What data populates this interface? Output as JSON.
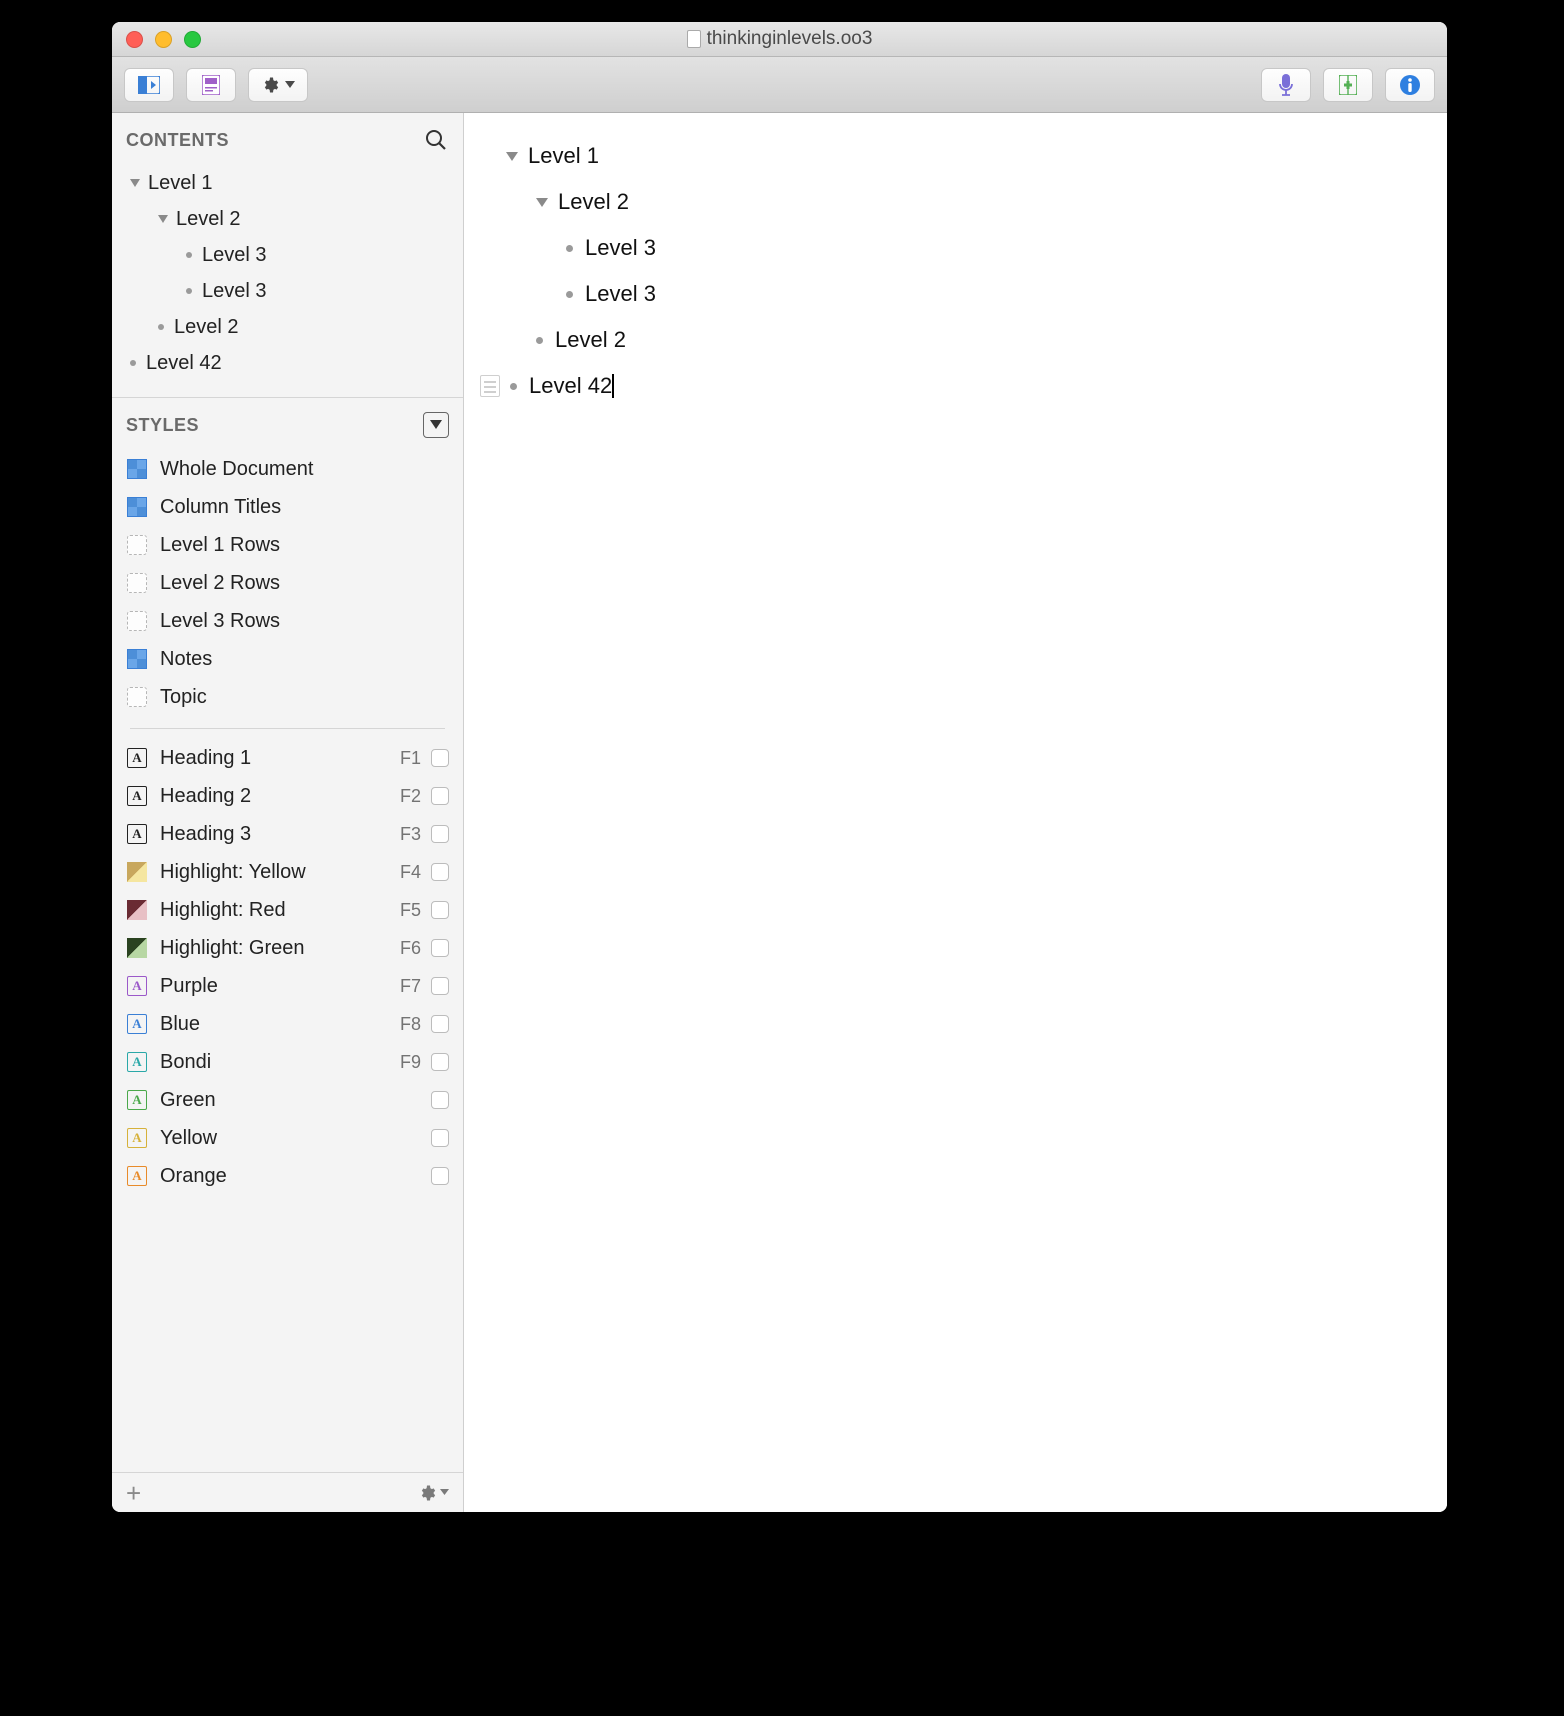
{
  "window": {
    "title": "thinkinginlevels.oo3"
  },
  "sidebar": {
    "contents_title": "CONTENTS",
    "styles_title": "STYLES",
    "tree": [
      {
        "label": "Level 1",
        "indent": 0,
        "marker": "tri"
      },
      {
        "label": "Level 2",
        "indent": 1,
        "marker": "tri"
      },
      {
        "label": "Level 3",
        "indent": 2,
        "marker": "bullet"
      },
      {
        "label": "Level 3",
        "indent": 2,
        "marker": "bullet"
      },
      {
        "label": "Level 2",
        "indent": 1,
        "marker": "bullet"
      },
      {
        "label": "Level 42",
        "indent": 0,
        "marker": "bullet"
      }
    ],
    "structural_styles": [
      {
        "label": "Whole Document",
        "icon": "blue"
      },
      {
        "label": "Column Titles",
        "icon": "blue"
      },
      {
        "label": "Level 1 Rows",
        "icon": "dashed"
      },
      {
        "label": "Level 2 Rows",
        "icon": "dashed"
      },
      {
        "label": "Level 3 Rows",
        "icon": "dashed"
      },
      {
        "label": "Notes",
        "icon": "blue"
      },
      {
        "label": "Topic",
        "icon": "dashed"
      }
    ],
    "named_styles": [
      {
        "label": "Heading 1",
        "shortcut": "F1",
        "icon": "A",
        "color": "#222"
      },
      {
        "label": "Heading 2",
        "shortcut": "F2",
        "icon": "A",
        "color": "#222"
      },
      {
        "label": "Heading 3",
        "shortcut": "F3",
        "icon": "A",
        "color": "#222"
      },
      {
        "label": "Highlight: Yellow",
        "shortcut": "F4",
        "icon": "swatch-yellow"
      },
      {
        "label": "Highlight: Red",
        "shortcut": "F5",
        "icon": "swatch-red"
      },
      {
        "label": "Highlight: Green",
        "shortcut": "F6",
        "icon": "swatch-green"
      },
      {
        "label": "Purple",
        "shortcut": "F7",
        "icon": "A",
        "color": "#9b59c9"
      },
      {
        "label": "Blue",
        "shortcut": "F8",
        "icon": "A",
        "color": "#3a7fd5"
      },
      {
        "label": "Bondi",
        "shortcut": "F9",
        "icon": "A",
        "color": "#2aa8a8"
      },
      {
        "label": "Green",
        "shortcut": "",
        "icon": "A",
        "color": "#4aa84a"
      },
      {
        "label": "Yellow",
        "shortcut": "",
        "icon": "A",
        "color": "#d6b13a"
      },
      {
        "label": "Orange",
        "shortcut": "",
        "icon": "A",
        "color": "#e88b2a"
      }
    ]
  },
  "outline": [
    {
      "label": "Level 1",
      "indent": 0,
      "marker": "tri",
      "selected": false
    },
    {
      "label": "Level 2",
      "indent": 1,
      "marker": "tri",
      "selected": false
    },
    {
      "label": "Level 3",
      "indent": 2,
      "marker": "bullet",
      "selected": false
    },
    {
      "label": "Level 3",
      "indent": 2,
      "marker": "bullet",
      "selected": false
    },
    {
      "label": "Level 2",
      "indent": 1,
      "marker": "bullet",
      "selected": false
    },
    {
      "label": "Level 42",
      "indent": 0,
      "marker": "bullet",
      "selected": true
    }
  ]
}
